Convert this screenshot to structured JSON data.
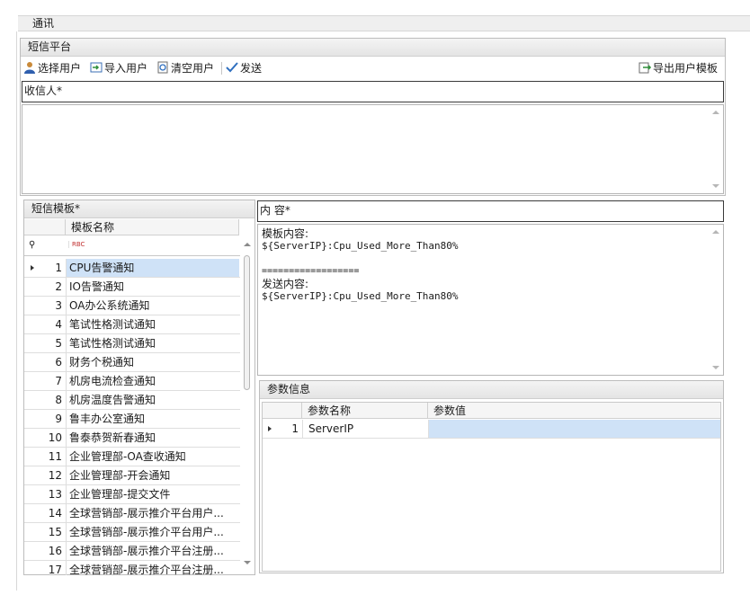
{
  "tab": {
    "title": "通讯"
  },
  "sms_platform": {
    "title": "短信平台",
    "toolbar": {
      "select_users": "选择用户",
      "import_users": "导入用户",
      "clear_users": "清空用户",
      "send": "发送",
      "export_template": "导出用户模板"
    },
    "recipients_label": "收信人*"
  },
  "templates": {
    "title": "短信模板*",
    "column_header": "模板名称",
    "filter_glyph": "RBC",
    "rows": [
      {
        "no": "1",
        "name": "CPU告警通知"
      },
      {
        "no": "2",
        "name": "IO告警通知"
      },
      {
        "no": "3",
        "name": "OA办公系统通知"
      },
      {
        "no": "4",
        "name": "笔试性格测试通知"
      },
      {
        "no": "5",
        "name": "笔试性格测试通知"
      },
      {
        "no": "6",
        "name": "财务个税通知"
      },
      {
        "no": "7",
        "name": "机房电流检查通知"
      },
      {
        "no": "8",
        "name": "机房温度告警通知"
      },
      {
        "no": "9",
        "name": "鲁丰办公室通知"
      },
      {
        "no": "10",
        "name": "鲁泰恭贺新春通知"
      },
      {
        "no": "11",
        "name": "企业管理部-OA查收通知"
      },
      {
        "no": "12",
        "name": "企业管理部-开会通知"
      },
      {
        "no": "13",
        "name": "企业管理部-提交文件"
      },
      {
        "no": "14",
        "name": "全球营销部-展示推介平台用户..."
      },
      {
        "no": "15",
        "name": "全球营销部-展示推介平台用户..."
      },
      {
        "no": "16",
        "name": "全球营销部-展示推介平台注册..."
      },
      {
        "no": "17",
        "name": "全球营销部-展示推介平台注册..."
      }
    ]
  },
  "content": {
    "label": "内  容*",
    "template_label": "模板内容:",
    "template_text": "${ServerIP}:Cpu_Used_More_Than80%",
    "divider": "==================",
    "send_label": "发送内容:",
    "send_text": "${ServerIP}:Cpu_Used_More_Than80%"
  },
  "params": {
    "title": "参数信息",
    "col_name": "参数名称",
    "col_value": "参数值",
    "rows": [
      {
        "no": "1",
        "name": "ServerIP",
        "value": ""
      }
    ]
  },
  "colors": {
    "selection": "#cfe2f7",
    "header": "#efefef"
  }
}
